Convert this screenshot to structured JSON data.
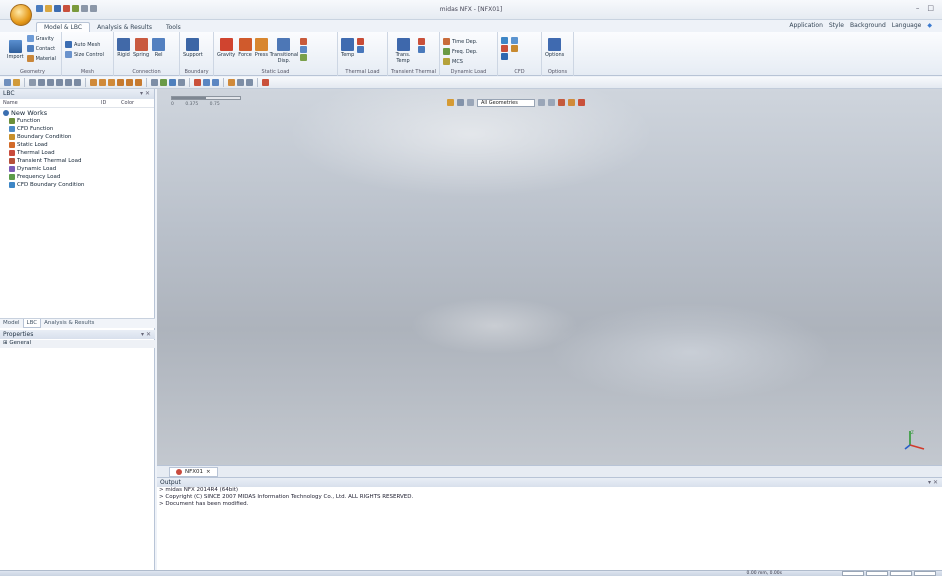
{
  "window": {
    "title": "midas NFX - [NFX01]",
    "min_label": "–",
    "max_label": "□"
  },
  "ribbon": {
    "tabs": [
      {
        "label": "Model & LBC"
      },
      {
        "label": "Analysis & Results"
      },
      {
        "label": "Tools"
      }
    ],
    "right_menu": [
      "Application",
      "Style",
      "Background",
      "Language"
    ],
    "groups": {
      "geometry": {
        "label": "Geometry",
        "import": "Import",
        "gravity": "Gravity",
        "contact": "Contact",
        "material": "Material"
      },
      "mesh": {
        "label": "Mesh",
        "auto_mesh": "Auto Mesh",
        "size_control": "Size Control"
      },
      "connection": {
        "label": "Connection",
        "rigid": "Rigid",
        "spring": "Spring",
        "rel": "Rel"
      },
      "boundary": {
        "label": "Boundary",
        "support": "Support"
      },
      "static_load": {
        "label": "Static Load",
        "gravity": "Gravity",
        "force": "Force",
        "press": "Press",
        "transitional": "Transitional Disp."
      },
      "thermal_load": {
        "label": "Thermal Load",
        "temp": "Temp"
      },
      "transient_thermal": {
        "label": "Transient Thermal",
        "trans_temp": "Trans. Temp"
      },
      "dynamic_load": {
        "label": "Dynamic Load",
        "time_dep": "Time Dep.",
        "freq_dep": "Freq. Dep.",
        "mcs": "MCS"
      },
      "cfd": {
        "label": "CFD"
      },
      "options": {
        "label": "Options",
        "options": "Options"
      }
    }
  },
  "left_panel": {
    "title": "LBC",
    "columns": {
      "name": "Name",
      "id": "ID",
      "color": "Color"
    },
    "tree": [
      {
        "label": "New Works",
        "icon": "works-icon",
        "color": "#3a6fb0"
      },
      {
        "label": "Function",
        "icon": "function-icon",
        "color": "#6b8f3a"
      },
      {
        "label": "CFD Function",
        "icon": "cfd-function-icon",
        "color": "#4b8ac8"
      },
      {
        "label": "Boundary Condition",
        "icon": "boundary-icon",
        "color": "#c8902b"
      },
      {
        "label": "Static Load",
        "icon": "static-load-icon",
        "color": "#d26a2a"
      },
      {
        "label": "Thermal Load",
        "icon": "thermal-load-icon",
        "color": "#c94b3c"
      },
      {
        "label": "Transient Thermal Load",
        "icon": "transient-thermal-icon",
        "color": "#b6503a"
      },
      {
        "label": "Dynamic Load",
        "icon": "dynamic-load-icon",
        "color": "#7b5bb8"
      },
      {
        "label": "Frequency Load",
        "icon": "frequency-load-icon",
        "color": "#5c9c4a"
      },
      {
        "label": "CFD Boundary Condition",
        "icon": "cfd-boundary-icon",
        "color": "#3d86c6"
      }
    ],
    "tabs": [
      "Model",
      "LBC",
      "Analysis & Results"
    ],
    "properties_title": "Properties",
    "properties_row": "General"
  },
  "viewport": {
    "scale_ticks": [
      "0",
      "0.375",
      "0.75"
    ],
    "filter_value": "All Geometries"
  },
  "doc_tab": {
    "label": "NFX01"
  },
  "output": {
    "title": "Output",
    "lines": [
      "> midas NFX 2014R4 (64bit)",
      "> Copyright (C) SINCE 2007 MIDAS Information Technology Co., Ltd. ALL RIGHTS RESERVED.",
      "> Document has been modified."
    ]
  },
  "status": {
    "text": "0.00 mm, 0.00s"
  }
}
